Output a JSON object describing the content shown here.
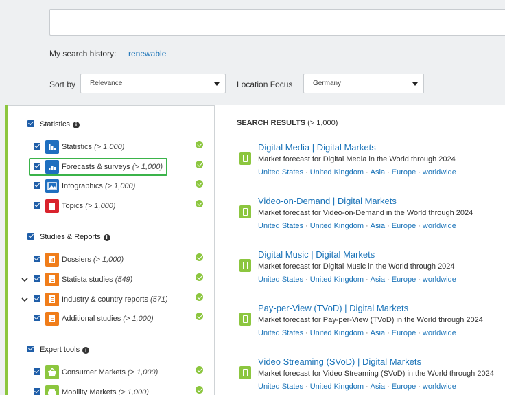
{
  "search": {
    "placeholder": ""
  },
  "history": {
    "label": "My search history:",
    "link": "renewable"
  },
  "sort": {
    "label": "Sort by",
    "value": "Relevance"
  },
  "location": {
    "label": "Location Focus",
    "value": "Germany"
  },
  "filters": {
    "statistics": {
      "title": "Statistics",
      "items": [
        {
          "label": "Statistics",
          "count": "(> 1,000)",
          "icon": "bar-chart-icon",
          "color": "#1f6fbf"
        },
        {
          "label": "Forecasts & surveys",
          "count": "(> 1,000)",
          "icon": "forecast-chart-icon",
          "color": "#1f6fbf"
        },
        {
          "label": "Infographics",
          "count": "(> 1,000)",
          "icon": "image-icon",
          "color": "#1f6fbf"
        },
        {
          "label": "Topics",
          "count": "(> 1,000)",
          "icon": "topic-book-icon",
          "color": "#d9232d"
        }
      ]
    },
    "studies": {
      "title": "Studies & Reports",
      "items": [
        {
          "label": "Dossiers",
          "count": "(> 1,000)",
          "icon": "document-icon",
          "color": "#f07d1a"
        },
        {
          "label": "Statista studies",
          "count": "(549)",
          "icon": "document-icon",
          "color": "#f07d1a"
        },
        {
          "label": "Industry & country reports",
          "count": "(571)",
          "icon": "document-icon",
          "color": "#f07d1a"
        },
        {
          "label": "Additional studies",
          "count": "(> 1,000)",
          "icon": "document-icon",
          "color": "#f07d1a"
        }
      ]
    },
    "expert": {
      "title": "Expert tools",
      "items": [
        {
          "label": "Consumer Markets",
          "count": "(> 1,000)",
          "icon": "basket-icon",
          "color": "#8cc63f"
        },
        {
          "label": "Mobility Markets",
          "count": "(> 1,000)",
          "icon": "car-icon",
          "color": "#8cc63f"
        }
      ]
    }
  },
  "results": {
    "heading": "SEARCH RESULTS",
    "count": "(> 1,000)",
    "items": [
      {
        "title": "Digital Media | Digital Markets",
        "desc": "Market forecast for Digital Media in the World through 2024",
        "tags": [
          "United States",
          "United Kingdom",
          "Asia",
          "Europe",
          "worldwide"
        ]
      },
      {
        "title": "Video-on-Demand | Digital Markets",
        "desc": "Market forecast for Video-on-Demand in the World through 2024",
        "tags": [
          "United States",
          "United Kingdom",
          "Asia",
          "Europe",
          "worldwide"
        ]
      },
      {
        "title": "Digital Music | Digital Markets",
        "desc": "Market forecast for Digital Music in the World through 2024",
        "tags": [
          "United States",
          "United Kingdom",
          "Asia",
          "Europe",
          "worldwide"
        ]
      },
      {
        "title": "Pay-per-View (TVoD) | Digital Markets",
        "desc": "Market forecast for Pay-per-View (TVoD) in the World through 2024",
        "tags": [
          "United States",
          "United Kingdom",
          "Asia",
          "Europe",
          "worldwide"
        ]
      },
      {
        "title": "Video Streaming (SVoD) | Digital Markets",
        "desc": "Market forecast for Video Streaming (SVoD) in the World through 2024",
        "tags": [
          "United States",
          "United Kingdom",
          "Asia",
          "Europe",
          "worldwide"
        ]
      }
    ]
  }
}
